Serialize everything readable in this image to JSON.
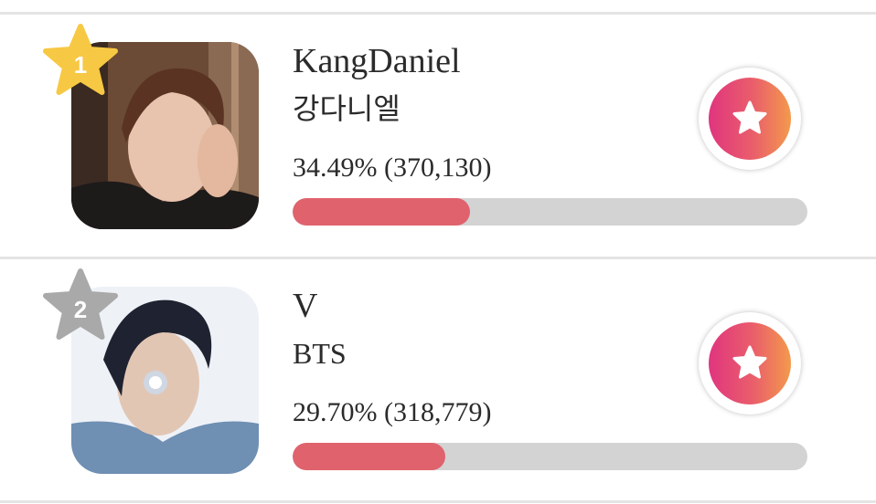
{
  "colors": {
    "gold_badge": "#f7c843",
    "silver_badge": "#a9a9a9",
    "progress_fill": "#e0626d",
    "progress_track": "#d3d3d3",
    "vote_gradient_start": "#e0357f",
    "vote_gradient_end": "#f39a4c"
  },
  "entries": [
    {
      "rank": "1",
      "name": "KangDaniel",
      "subtitle": "강다니엘",
      "stats": "34.49% (370,130)",
      "percent": 34.49,
      "votes": 370130,
      "badge_icon": "gold-star-icon",
      "vote_icon": "star-icon"
    },
    {
      "rank": "2",
      "name": "V",
      "subtitle": "BTS",
      "stats": "29.70% (318,779)",
      "percent": 29.7,
      "votes": 318779,
      "badge_icon": "silver-star-icon",
      "vote_icon": "star-icon"
    }
  ]
}
